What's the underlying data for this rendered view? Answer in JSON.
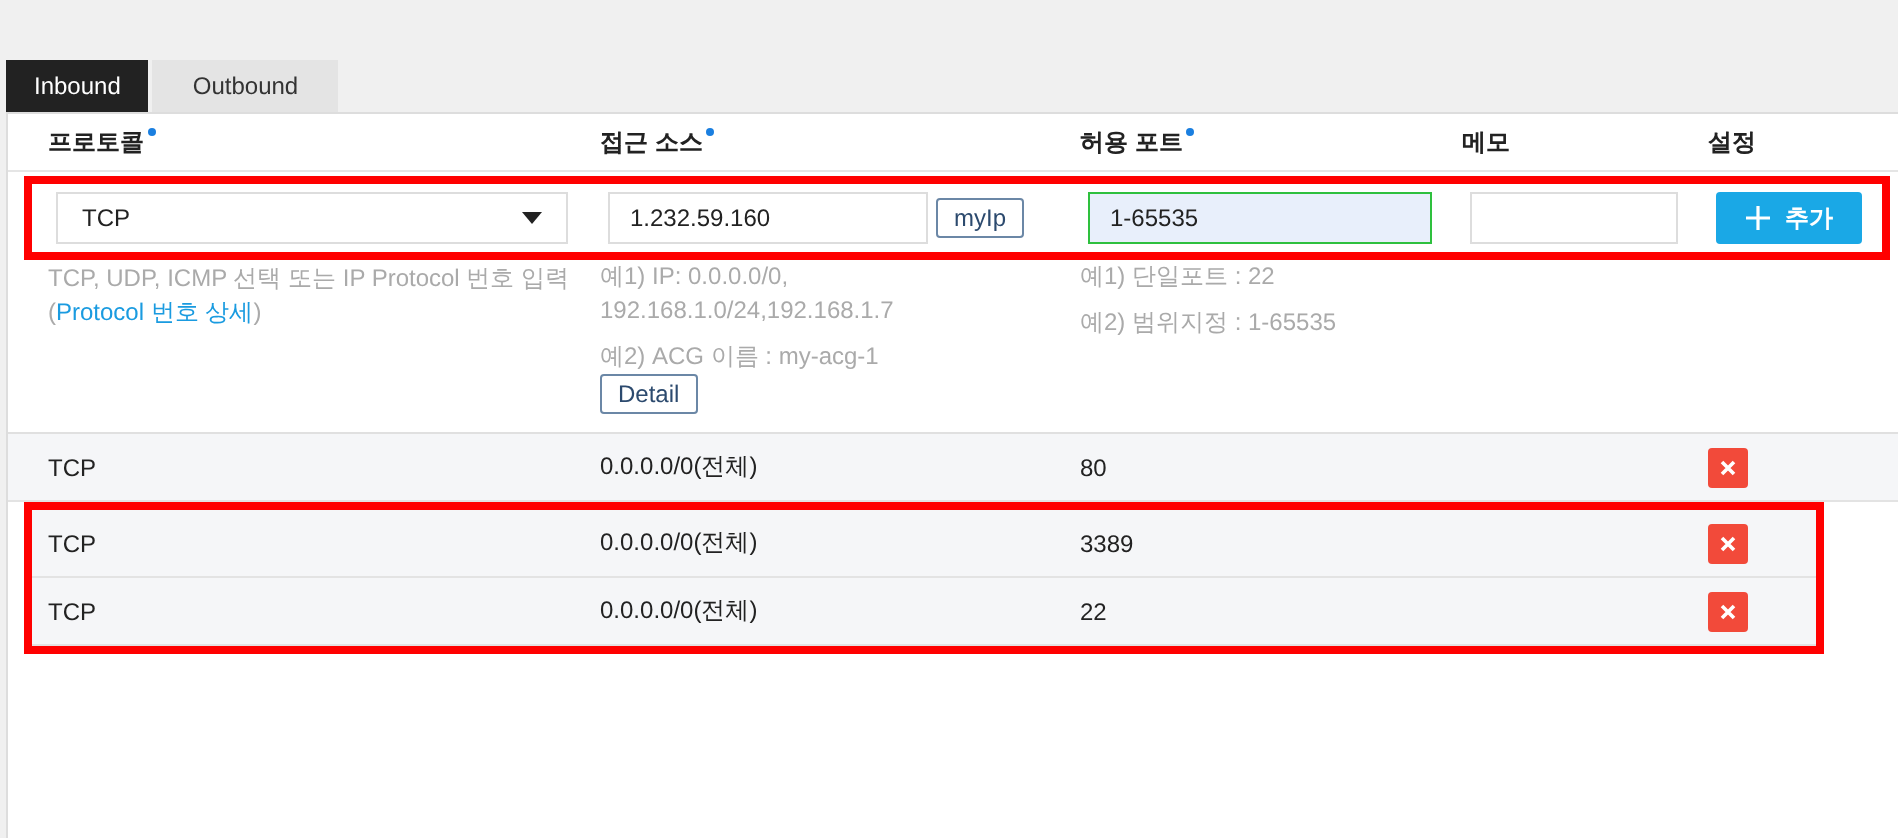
{
  "tabs": [
    {
      "label": "Inbound",
      "selected": true
    },
    {
      "label": "Outbound",
      "selected": false
    }
  ],
  "columns": [
    {
      "label": "프로토콜",
      "required": true
    },
    {
      "label": "접근 소스",
      "required": true
    },
    {
      "label": "허용 포트",
      "required": true
    },
    {
      "label": "메모",
      "required": false
    },
    {
      "label": "설정",
      "required": false
    }
  ],
  "form": {
    "highlighted": true,
    "protocol": "TCP",
    "source": "1.232.59.160",
    "myip_button": "myIp",
    "port": "1-65535",
    "port_focused": true,
    "add_button": "추가",
    "protocol_hint": "TCP, UDP, ICMP 선택 또는 IP Protocol 번호 입력",
    "protocol_link_open": "(",
    "protocol_link": "Protocol 번호 상세",
    "protocol_link_close": ")",
    "source_hints": [
      "예1) IP: 0.0.0.0/0,\n192.168.1.0/24,192.168.1.7",
      "예2) ACG 이름 : my-acg-1"
    ],
    "detail_button": "Detail",
    "port_hints": [
      "예1) 단일포트 : 22",
      "예2) 범위지정 : 1-65535"
    ]
  },
  "rows": [
    {
      "protocol": "TCP",
      "source": "0.0.0.0/0(전체)",
      "port": "80",
      "highlighted": false
    },
    {
      "protocol": "TCP",
      "source": "0.0.0.0/0(전체)",
      "port": "3389",
      "highlighted": true
    },
    {
      "protocol": "TCP",
      "source": "0.0.0.0/0(전체)",
      "port": "22",
      "highlighted": true
    }
  ]
}
